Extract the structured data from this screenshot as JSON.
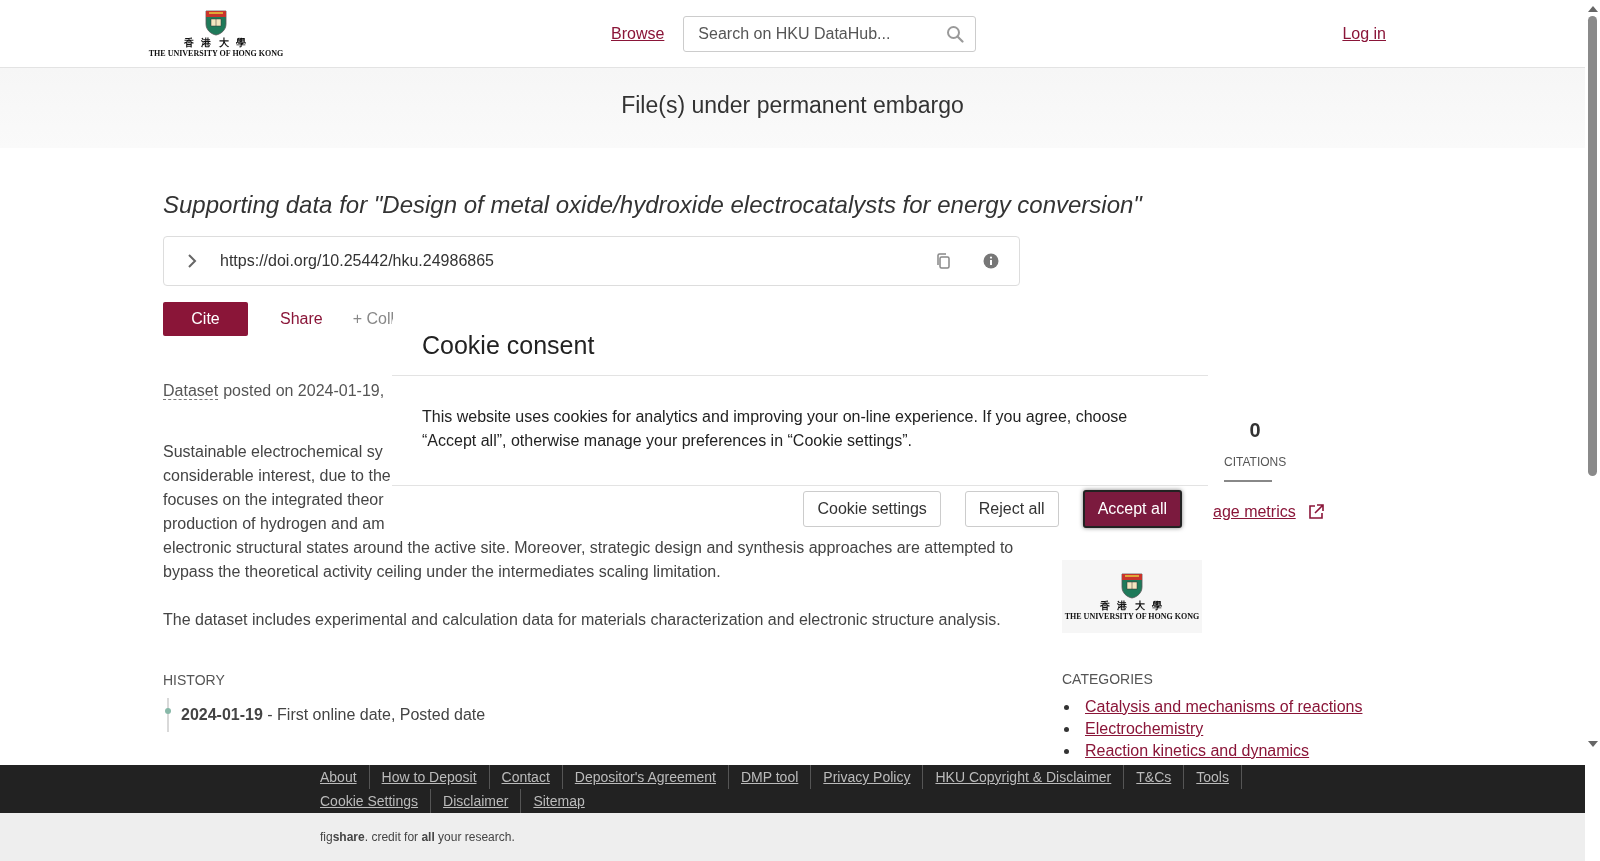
{
  "header": {
    "logo": {
      "chinese": "香 港 大 學",
      "english": "THE UNIVERSITY OF HONG KONG"
    },
    "browse_link": "Browse",
    "search": {
      "placeholder": "Search on HKU DataHub..."
    },
    "login_link": "Log in"
  },
  "embargo_banner": "File(s) under permanent embargo",
  "item": {
    "title": "Supporting data for \"Design of metal oxide/hydroxide electrocatalysts for energy conversion\"",
    "doi": "https://doi.org/10.25442/hku.24986865",
    "actions": [
      {
        "label": "Cite",
        "kind": "primary"
      },
      {
        "label": "Share",
        "kind": "link"
      },
      {
        "label": "+ Coll",
        "kind": "muted"
      }
    ],
    "posted": {
      "type_label": "Dataset",
      "text": "posted on 2024-01-19,"
    },
    "description_lines": [
      "Sustainable electrochemical sy",
      "considerable interest, due to the",
      "focuses on the integrated theor",
      "production of hydrogen and am",
      "electronic structural states around the active site. Moreover, strategic design and synthesis approaches are attempted to",
      "bypass the theoretical activity ceiling under the intermediates scaling limitation."
    ],
    "description_paragraph_2": "The dataset includes experimental and calculation data for materials characterization and electronic structure analysis.",
    "history": {
      "heading": "HISTORY",
      "events": [
        {
          "text": "**2024-01-19** - First online date, Posted date"
        }
      ]
    }
  },
  "sidebar": {
    "metrics": [
      {
        "value": "0",
        "label": "CITATIONS"
      }
    ],
    "usage_link": "age metrics",
    "logo": {
      "chinese": "香 港 大 學",
      "english": "THE UNIVERSITY OF HONG KONG"
    },
    "categories_heading": "CATEGORIES",
    "categories": [
      "Catalysis and mechanisms of reactions",
      "Electrochemistry",
      "Reaction kinetics and dynamics"
    ]
  },
  "footer": {
    "link_rows": [
      [
        "About",
        "How to Deposit",
        "Contact",
        "Depositor's Agreement",
        "DMP tool",
        "Privacy Policy",
        "HKU Copyright & Disclaimer",
        "T&Cs",
        "Tools"
      ],
      [
        "Cookie Settings",
        "Disclaimer",
        "Sitemap"
      ]
    ],
    "credit": "fig**share**. credit for **all** your research."
  },
  "cookie_dialog": {
    "title": "Cookie consent",
    "text": "This website uses cookies for analytics and improving your on-line experience. If you agree, choose “Accept all”, otherwise manage your preferences in “Cookie settings”.",
    "buttons": [
      {
        "label": "Cookie settings",
        "kind": "secondary"
      },
      {
        "label": "Reject all",
        "kind": "secondary"
      },
      {
        "label": "Accept all",
        "kind": "primary"
      }
    ]
  }
}
